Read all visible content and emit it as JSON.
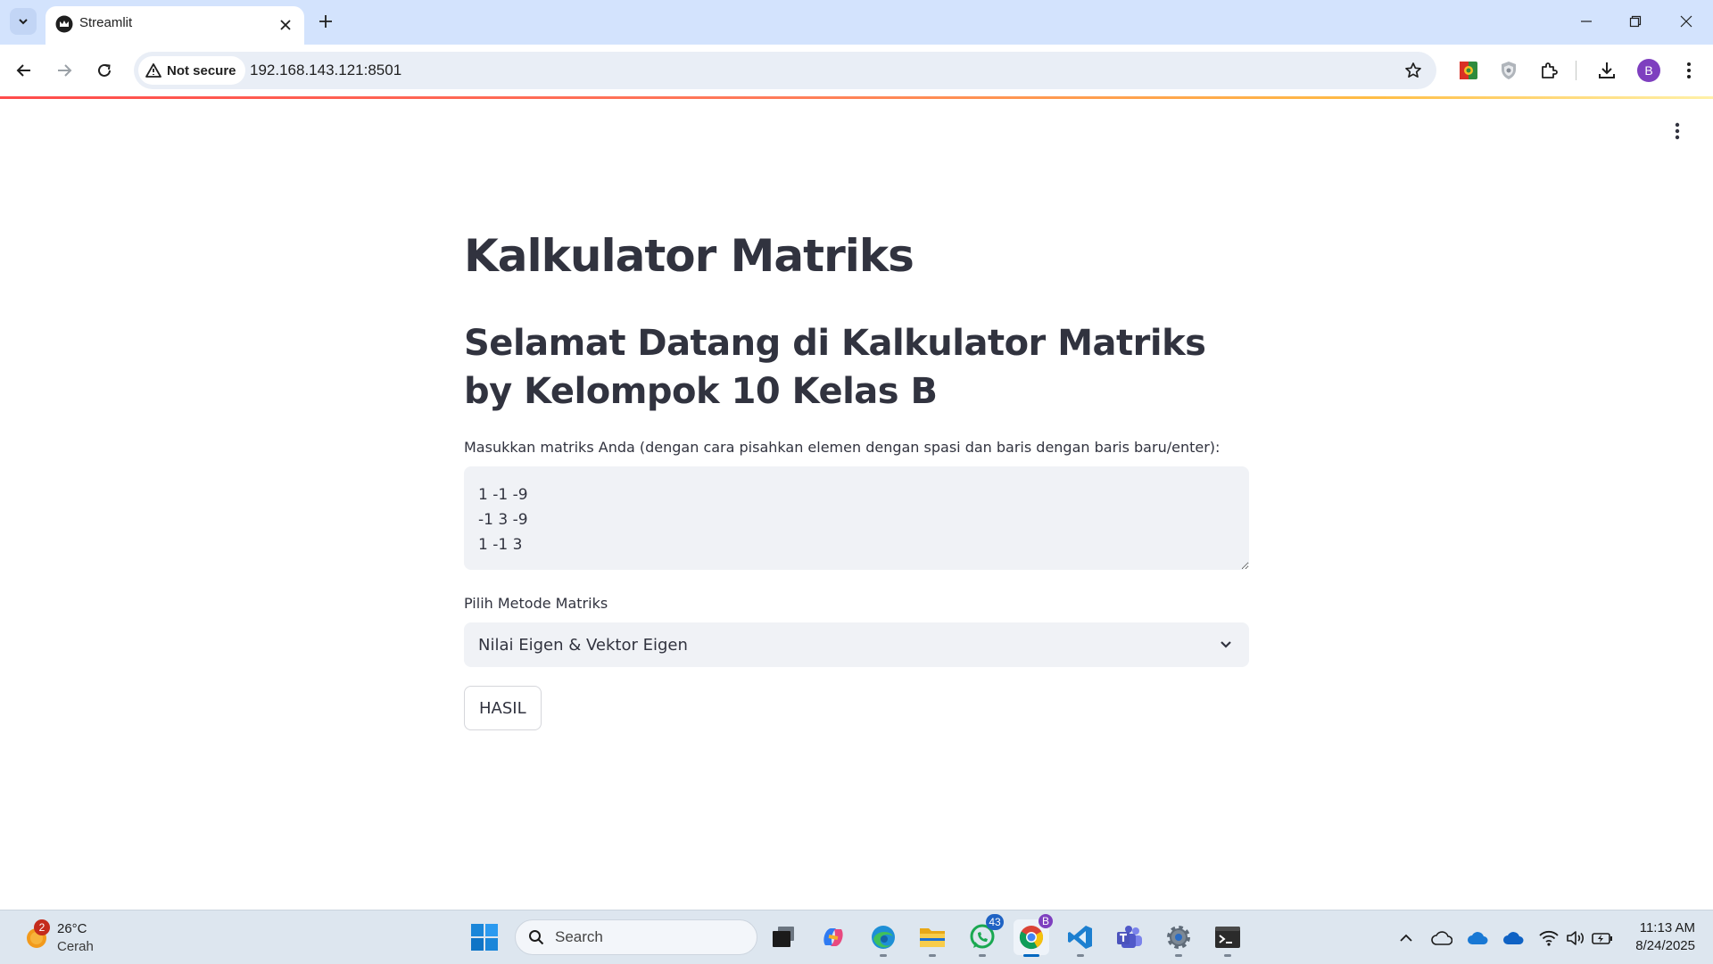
{
  "browser": {
    "tab": {
      "title": "Streamlit",
      "favicon": "streamlit-crown-icon"
    },
    "toolbar": {
      "security_label": "Not secure",
      "url": "192.168.143.121:8501",
      "profile_initial": "B"
    }
  },
  "page": {
    "title": "Kalkulator Matriks",
    "subtitle": "Selamat Datang di Kalkulator Matriks by Kelompok 10 Kelas B",
    "matrix_input": {
      "label": "Masukkan matriks Anda (dengan cara pisahkan elemen dengan spasi dan baris dengan baris baru/enter):",
      "value": "1 -1 -9\n-1 3 -9\n1 -1 3"
    },
    "method_select": {
      "label": "Pilih Metode Matriks",
      "selected": "Nilai Eigen & Vektor Eigen"
    },
    "submit_label": "HASIL"
  },
  "taskbar": {
    "weather": {
      "temperature": "26°C",
      "condition": "Cerah",
      "badge": "2"
    },
    "search_placeholder": "Search",
    "whatsapp_badge": "43",
    "chrome_badge": "B",
    "time": "11:13 AM",
    "date": "8/24/2025"
  },
  "colors": {
    "tab_strip": "#d3e3fd",
    "streamlit_text": "#31333f",
    "input_background": "#f0f2f6",
    "streamlit_accent": "#ff4b4b"
  }
}
